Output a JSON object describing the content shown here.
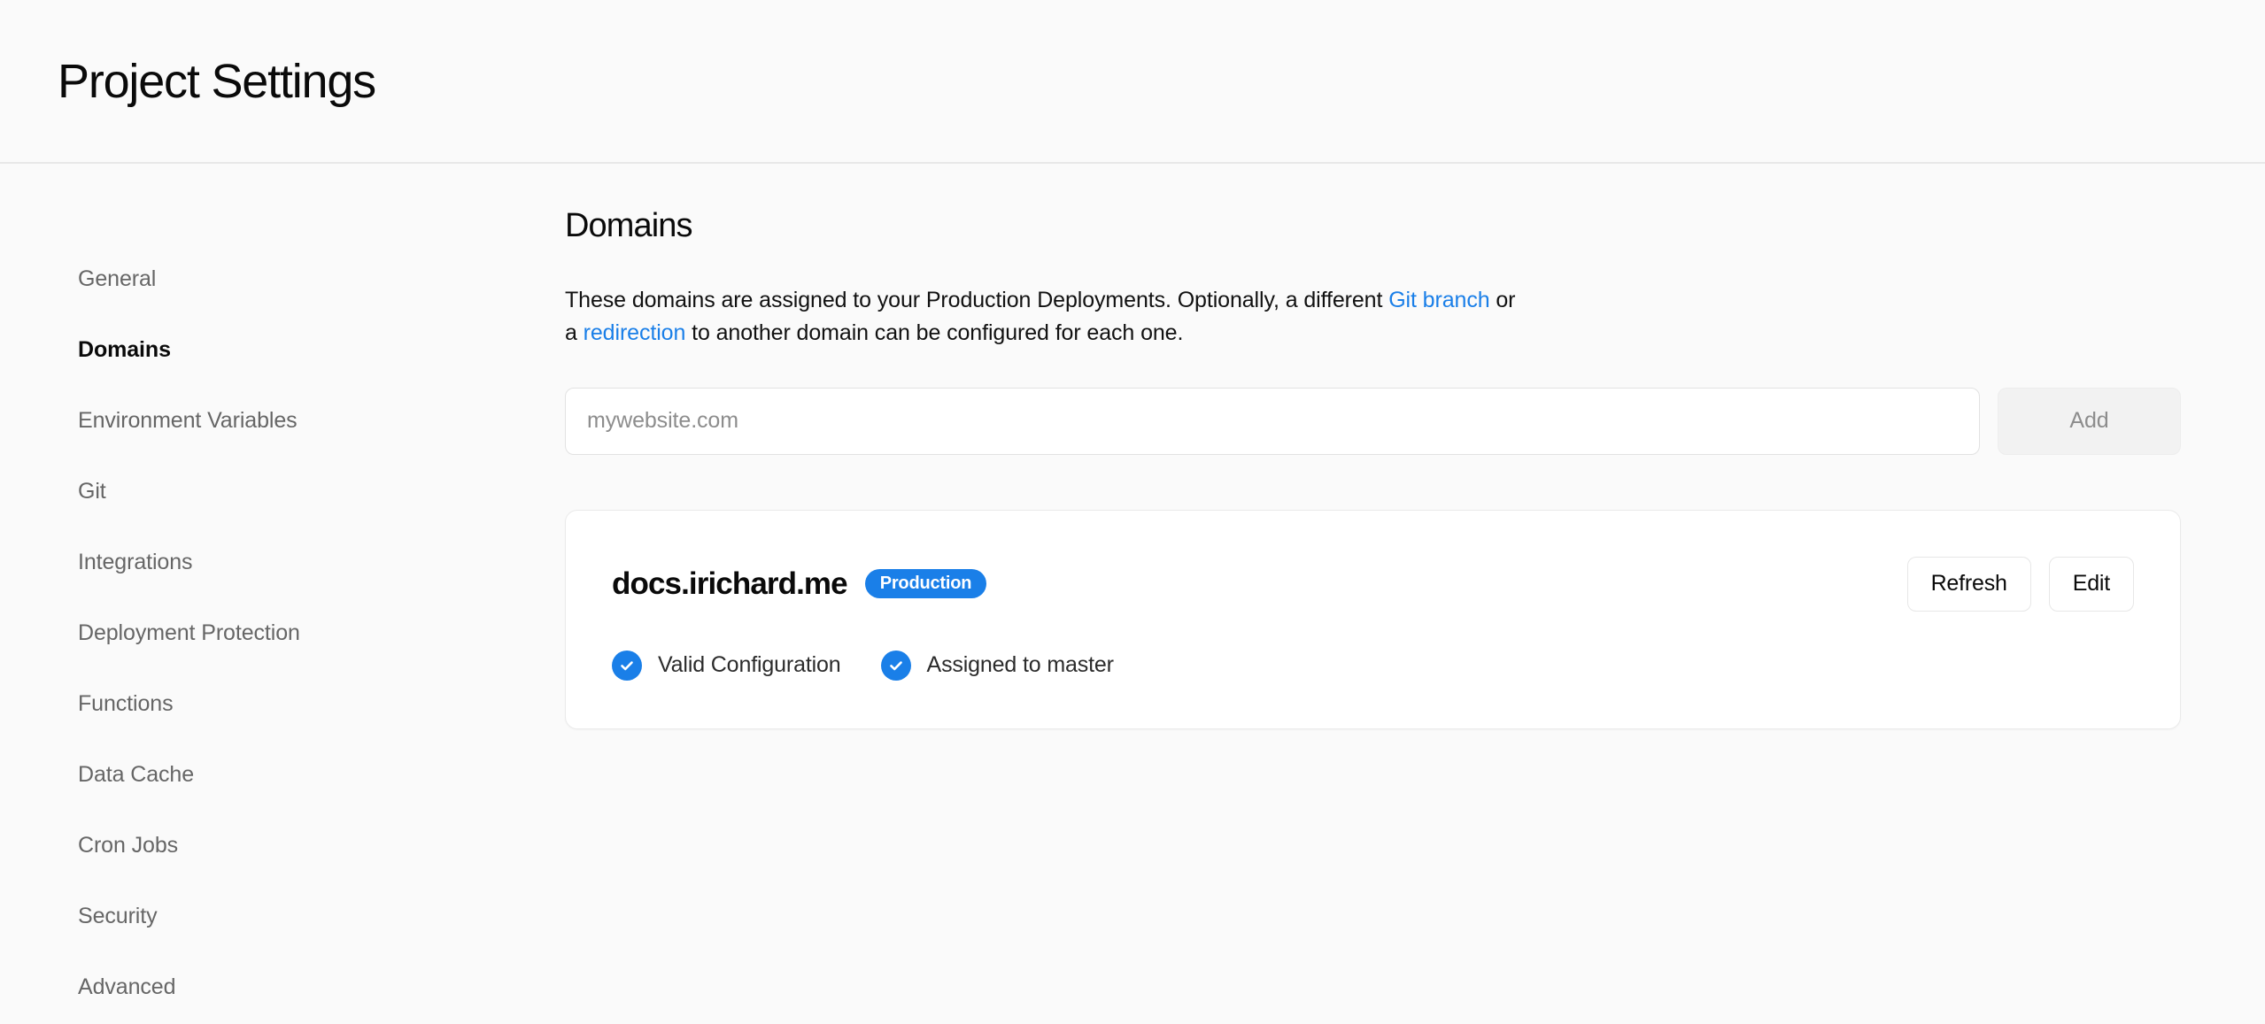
{
  "header": {
    "title": "Project Settings"
  },
  "sidebar": {
    "items": [
      {
        "label": "General",
        "active": false
      },
      {
        "label": "Domains",
        "active": true
      },
      {
        "label": "Environment Variables",
        "active": false
      },
      {
        "label": "Git",
        "active": false
      },
      {
        "label": "Integrations",
        "active": false
      },
      {
        "label": "Deployment Protection",
        "active": false
      },
      {
        "label": "Functions",
        "active": false
      },
      {
        "label": "Data Cache",
        "active": false
      },
      {
        "label": "Cron Jobs",
        "active": false
      },
      {
        "label": "Security",
        "active": false
      },
      {
        "label": "Advanced",
        "active": false
      }
    ]
  },
  "main": {
    "section_title": "Domains",
    "description": {
      "part1": "These domains are assigned to your Production Deployments. Optionally, a different ",
      "link1": "Git branch",
      "part2": " or a ",
      "link2": "redirection",
      "part3": " to another domain can be configured for each one."
    },
    "add_domain": {
      "input_placeholder": "mywebsite.com",
      "input_value": "",
      "add_label": "Add"
    },
    "domain_card": {
      "domain": "docs.irichard.me",
      "badge": "Production",
      "refresh_label": "Refresh",
      "edit_label": "Edit",
      "statuses": [
        {
          "icon": "check-circle-icon",
          "label": "Valid Configuration"
        },
        {
          "icon": "check-circle-icon",
          "label": "Assigned to master"
        }
      ]
    }
  },
  "colors": {
    "accent": "#1a7fe8",
    "link": "#1a7fe8",
    "page_bg": "#fafafa",
    "card_bg": "#ffffff",
    "border": "#eaeaea",
    "muted_text": "#666666"
  }
}
